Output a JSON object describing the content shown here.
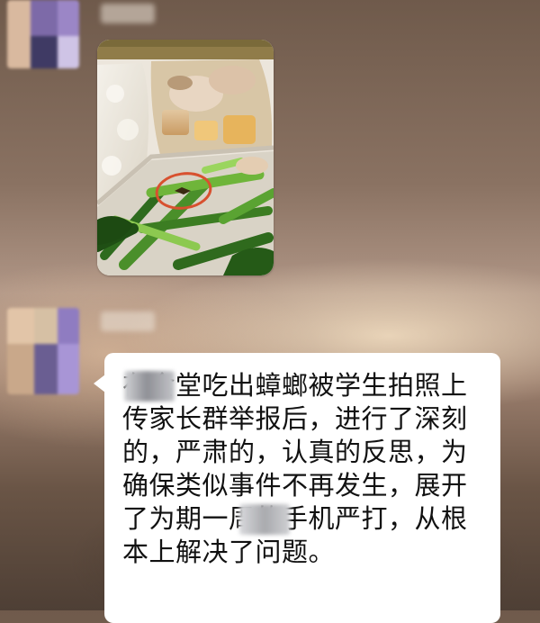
{
  "chat": {
    "messages": [
      {
        "type": "image",
        "avatar_icon": "blurred-avatar",
        "image_icon": "lunch-tray-photo",
        "highlight_color": "#d8512f"
      },
      {
        "type": "text",
        "avatar_icon": "blurred-avatar",
        "text": "在食堂吃出蟑螂被学生拍照上传家长群举报后，进行了深刻的，严肃的，认真的反思，为确保类似事件不再发生，展开了为期一周的手机严打，从根本上解决了问题。"
      }
    ]
  },
  "colors": {
    "bubble": "#ffffff",
    "text": "#111111"
  }
}
